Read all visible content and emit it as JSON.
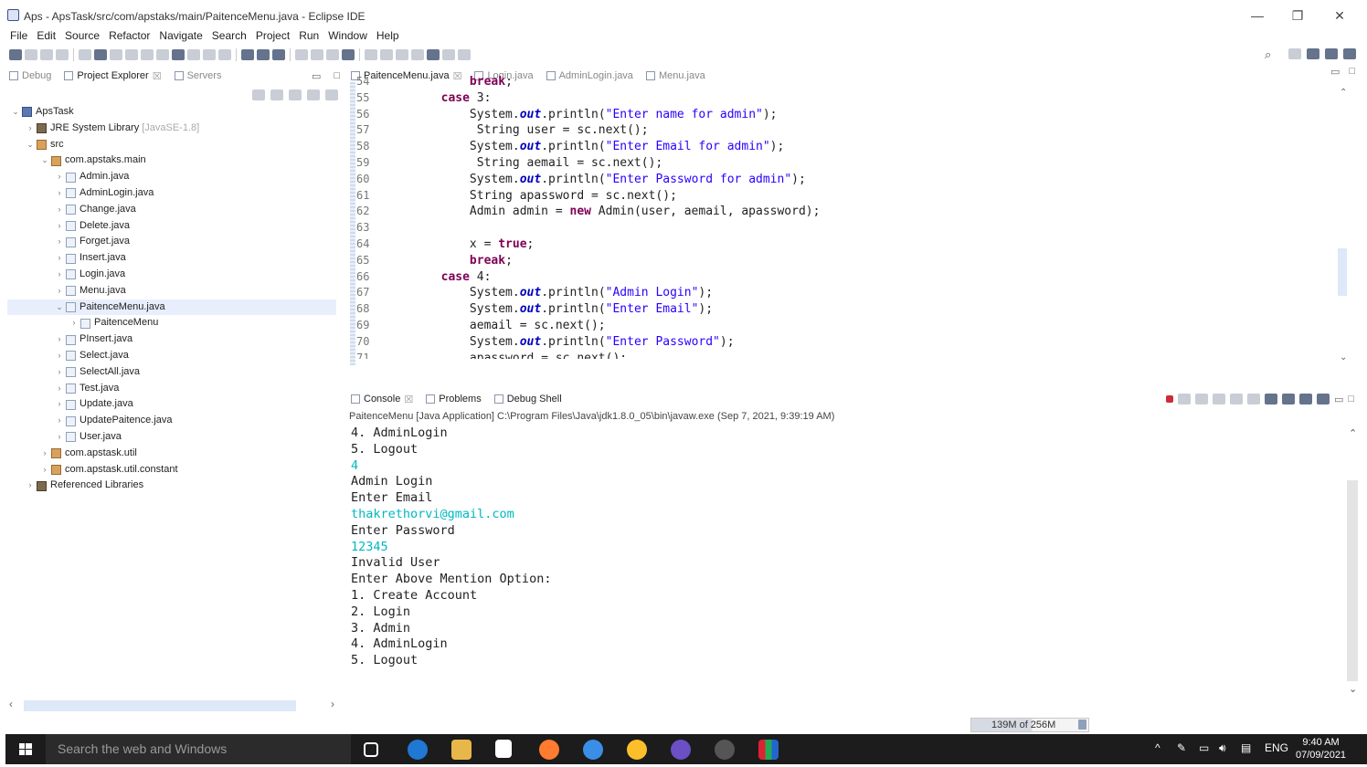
{
  "window": {
    "title": "Aps - ApsTask/src/com/apstaks/main/PaitenceMenu.java - Eclipse IDE",
    "minimize": "—",
    "restore": "❐",
    "close": "✕"
  },
  "menu": [
    "File",
    "Edit",
    "Source",
    "Refactor",
    "Navigate",
    "Search",
    "Project",
    "Run",
    "Window",
    "Help"
  ],
  "left_tabs": {
    "debug": "Debug",
    "explorer": "Project Explorer",
    "servers": "Servers"
  },
  "tree": [
    {
      "label": "ApsTask",
      "indent": 0,
      "twisty": "v",
      "kind": "proj"
    },
    {
      "label": "JRE System Library",
      "suffix": "[JavaSE-1.8]",
      "indent": 1,
      "twisty": ">",
      "kind": "lib"
    },
    {
      "label": "src",
      "indent": 1,
      "twisty": "v",
      "kind": "pkg"
    },
    {
      "label": "com.apstaks.main",
      "indent": 2,
      "twisty": "v",
      "kind": "pkg"
    },
    {
      "label": "Admin.java",
      "indent": 3,
      "twisty": ">",
      "kind": "java"
    },
    {
      "label": "AdminLogin.java",
      "indent": 3,
      "twisty": ">",
      "kind": "java"
    },
    {
      "label": "Change.java",
      "indent": 3,
      "twisty": ">",
      "kind": "java"
    },
    {
      "label": "Delete.java",
      "indent": 3,
      "twisty": ">",
      "kind": "java"
    },
    {
      "label": "Forget.java",
      "indent": 3,
      "twisty": ">",
      "kind": "java"
    },
    {
      "label": "Insert.java",
      "indent": 3,
      "twisty": ">",
      "kind": "java"
    },
    {
      "label": "Login.java",
      "indent": 3,
      "twisty": ">",
      "kind": "java"
    },
    {
      "label": "Menu.java",
      "indent": 3,
      "twisty": ">",
      "kind": "java"
    },
    {
      "label": "PaitenceMenu.java",
      "indent": 3,
      "twisty": "v",
      "kind": "java",
      "selected": true
    },
    {
      "label": "PaitenceMenu",
      "indent": 4,
      "twisty": ">",
      "kind": "class"
    },
    {
      "label": "PInsert.java",
      "indent": 3,
      "twisty": ">",
      "kind": "java"
    },
    {
      "label": "Select.java",
      "indent": 3,
      "twisty": ">",
      "kind": "java"
    },
    {
      "label": "SelectAll.java",
      "indent": 3,
      "twisty": ">",
      "kind": "java"
    },
    {
      "label": "Test.java",
      "indent": 3,
      "twisty": ">",
      "kind": "java"
    },
    {
      "label": "Update.java",
      "indent": 3,
      "twisty": ">",
      "kind": "java"
    },
    {
      "label": "UpdatePaitence.java",
      "indent": 3,
      "twisty": ">",
      "kind": "java"
    },
    {
      "label": "User.java",
      "indent": 3,
      "twisty": ">",
      "kind": "java"
    },
    {
      "label": "com.apstask.util",
      "indent": 2,
      "twisty": ">",
      "kind": "pkg"
    },
    {
      "label": "com.apstask.util.constant",
      "indent": 2,
      "twisty": ">",
      "kind": "pkg"
    },
    {
      "label": "Referenced Libraries",
      "indent": 1,
      "twisty": ">",
      "kind": "lib"
    }
  ],
  "editor_tabs": [
    "PaitenceMenu.java",
    "Login.java",
    "AdminLogin.java",
    "Menu.java"
  ],
  "code": [
    {
      "n": "54",
      "html": "            <span class=\"kw\">break</span>;"
    },
    {
      "n": "55",
      "html": "        <span class=\"kw\">case</span> 3:"
    },
    {
      "n": "56",
      "html": "            System.<span class=\"fld\">out</span>.println(<span class=\"str\">\"Enter name for admin\"</span>);"
    },
    {
      "n": "57",
      "html": "             String user = sc.next();"
    },
    {
      "n": "58",
      "html": "            System.<span class=\"fld\">out</span>.println(<span class=\"str\">\"Enter Email for admin\"</span>);"
    },
    {
      "n": "59",
      "html": "             String aemail = sc.next();"
    },
    {
      "n": "60",
      "html": "            System.<span class=\"fld\">out</span>.println(<span class=\"str\">\"Enter Password for admin\"</span>);"
    },
    {
      "n": "61",
      "html": "            String apassword = sc.next();"
    },
    {
      "n": "62",
      "html": "            Admin admin = <span class=\"kw\">new</span> Admin(user, aemail, apassword);"
    },
    {
      "n": "63",
      "html": ""
    },
    {
      "n": "64",
      "html": "            x = <span class=\"kw\">true</span>;"
    },
    {
      "n": "65",
      "html": "            <span class=\"kw\">break</span>;"
    },
    {
      "n": "66",
      "html": "        <span class=\"kw\">case</span> 4:"
    },
    {
      "n": "67",
      "html": "            System.<span class=\"fld\">out</span>.println(<span class=\"str\">\"Admin Login\"</span>);"
    },
    {
      "n": "68",
      "html": "            System.<span class=\"fld\">out</span>.println(<span class=\"str\">\"Enter Email\"</span>);"
    },
    {
      "n": "69",
      "html": "            aemail = sc.next();"
    },
    {
      "n": "70",
      "html": "            System.<span class=\"fld\">out</span>.println(<span class=\"str\">\"Enter Password\"</span>);"
    },
    {
      "n": "71",
      "html": "            apassword = sc.next();"
    }
  ],
  "console_tabs": {
    "console": "Console",
    "problems": "Problems",
    "debug_shell": "Debug Shell"
  },
  "console_header": "PaitenceMenu [Java Application] C:\\Program Files\\Java\\jdk1.8.0_05\\bin\\javaw.exe (Sep 7, 2021, 9:39:19 AM)",
  "console_lines": [
    {
      "t": "4. AdminLogin",
      "inp": false
    },
    {
      "t": "5. Logout",
      "inp": false
    },
    {
      "t": "4",
      "inp": true
    },
    {
      "t": "Admin Login",
      "inp": false
    },
    {
      "t": "Enter Email",
      "inp": false
    },
    {
      "t": "thakrethorvi@gmail.com",
      "inp": true
    },
    {
      "t": "Enter Password",
      "inp": false
    },
    {
      "t": "12345",
      "inp": true
    },
    {
      "t": "Invalid User",
      "inp": false
    },
    {
      "t": "Enter Above Mention Option:",
      "inp": false
    },
    {
      "t": "1. Create Account",
      "inp": false
    },
    {
      "t": "2. Login",
      "inp": false
    },
    {
      "t": "3. Admin",
      "inp": false
    },
    {
      "t": "4. AdminLogin",
      "inp": false
    },
    {
      "t": "5. Logout",
      "inp": false
    }
  ],
  "heap": "139M of 256M",
  "taskbar": {
    "search_placeholder": "Search the web and Windows",
    "lang": "ENG",
    "time": "9:40 AM",
    "date": "07/09/2021"
  },
  "colors": {
    "keyword": "#7f0055",
    "string": "#2a00ff",
    "field": "#0000c0",
    "console_input": "#00b8c0"
  }
}
